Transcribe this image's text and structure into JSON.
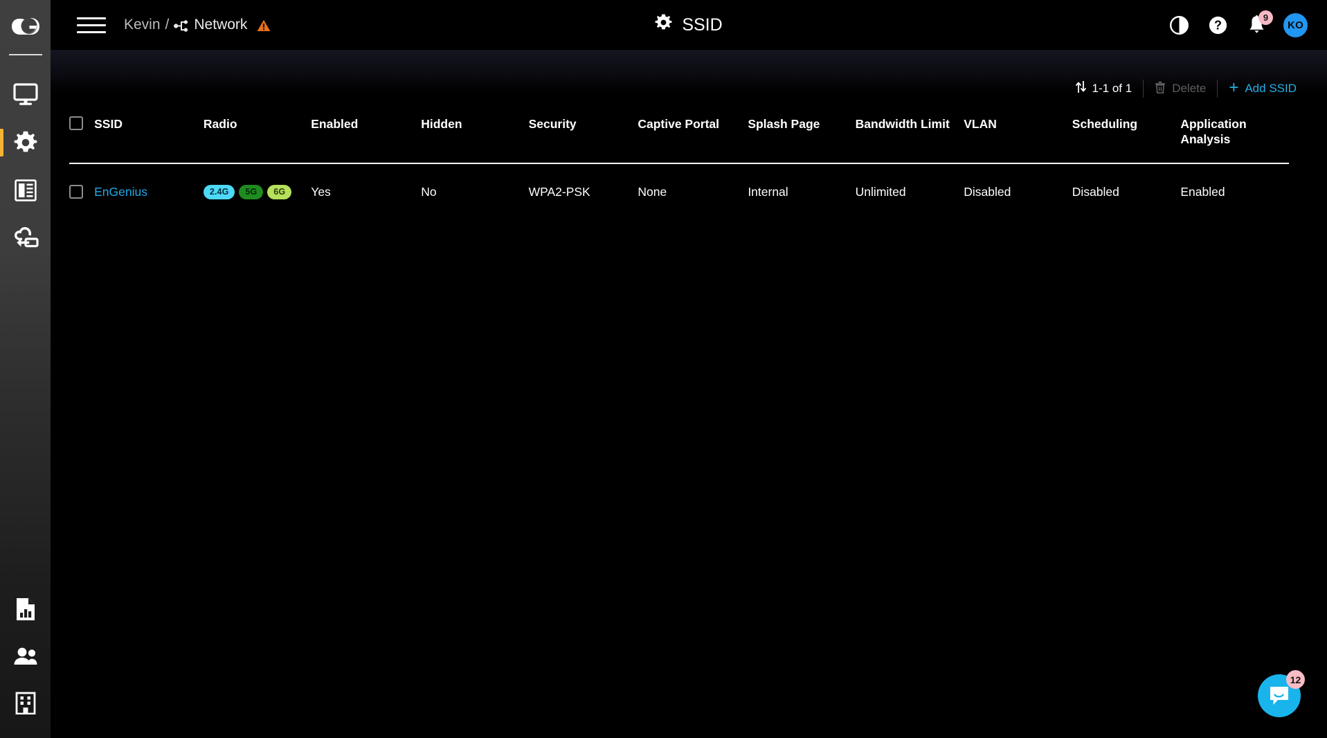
{
  "sidebar": {
    "logo": {
      "name": "engenius-cloud-logo",
      "letter": "G"
    },
    "top_items": [
      {
        "icon": "monitor-icon",
        "label": "Dashboard",
        "active": false
      },
      {
        "icon": "gear-icon",
        "label": "Configure",
        "active": true
      },
      {
        "icon": "layout-list-icon",
        "label": "Manage",
        "active": false
      },
      {
        "icon": "cloud-device-icon",
        "label": "Devices",
        "active": false
      }
    ],
    "bottom_items": [
      {
        "icon": "report-chart-icon",
        "label": "Reports"
      },
      {
        "icon": "users-icon",
        "label": "Users"
      },
      {
        "icon": "building-icon",
        "label": "Organization"
      }
    ]
  },
  "header": {
    "menu_icon": "hamburger-icon",
    "breadcrumb": {
      "user": "Kevin",
      "separator": "/",
      "network_icon": "network-topology-icon",
      "network": "Network",
      "warning_icon": "warning-triangle-icon"
    },
    "page_title": "SSID",
    "page_title_icon": "gear-icon",
    "right_icons": [
      {
        "name": "contrast-toggle-icon",
        "label": "Contrast"
      },
      {
        "name": "help-icon",
        "label": "Help"
      }
    ],
    "notifications": {
      "icon": "bell-icon",
      "count": "9"
    },
    "avatar": {
      "initials": "KO"
    }
  },
  "toolbar": {
    "sort_icon": "sort-arrows-icon",
    "pagination": "1-1 of 1",
    "delete_icon": "trash-icon",
    "delete_label": "Delete",
    "add_icon": "plus-icon",
    "add_label": "Add SSID"
  },
  "table": {
    "select_all_checkbox": "unchecked",
    "columns": [
      "SSID",
      "Radio",
      "Enabled",
      "Hidden",
      "Security",
      "Captive Portal",
      "Splash Page",
      "Bandwidth Limit",
      "VLAN",
      "Scheduling",
      "Application Analysis"
    ],
    "rows": [
      {
        "checkbox": "unchecked",
        "ssid": "EnGenius",
        "radio": [
          {
            "label": "2.4G",
            "color": "#4dd9f7"
          },
          {
            "label": "5G",
            "color": "#1f8c1f"
          },
          {
            "label": "6G",
            "color": "#b7e05c"
          }
        ],
        "enabled": "Yes",
        "hidden": "No",
        "security": "WPA2-PSK",
        "captive_portal": "None",
        "splash_page": "Internal",
        "bandwidth_limit": "Unlimited",
        "vlan": "Disabled",
        "scheduling": "Disabled",
        "application_analysis": "Enabled"
      }
    ]
  },
  "chat_widget": {
    "icon": "chat-bubble-icon",
    "unread": "12",
    "color": "#1ab4ec"
  },
  "colors": {
    "accent_link": "#22a9e8",
    "active_indicator": "#f5b335",
    "warning": "#e8711a",
    "badge_pink": "#f8bcc6",
    "avatar_blue": "#2196f3"
  }
}
